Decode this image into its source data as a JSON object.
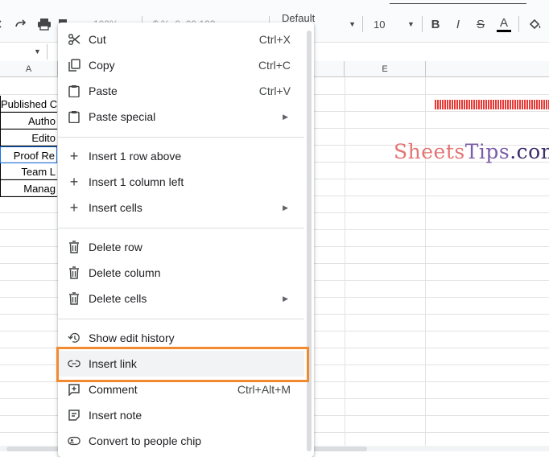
{
  "toolbar": {
    "zoom": "100%",
    "font_name": "Default (Ari...",
    "font_size": "10",
    "bold": "B",
    "italic": "I",
    "strikethrough": "S",
    "text_color": "A",
    "faded_tools": "$   %   .0   .00   123"
  },
  "columns": {
    "a": "A",
    "e": "E"
  },
  "cells": [
    "Published C",
    "Autho",
    "Edito",
    "Proof Re",
    "Team L",
    "Manag"
  ],
  "watermark": {
    "part1": "Sheets",
    "part2": "Tips",
    "part3": ".com"
  },
  "menu": {
    "cut": {
      "label": "Cut",
      "shortcut": "Ctrl+X"
    },
    "copy": {
      "label": "Copy",
      "shortcut": "Ctrl+C"
    },
    "paste": {
      "label": "Paste",
      "shortcut": "Ctrl+V"
    },
    "paste_special": {
      "label": "Paste special"
    },
    "insert_row_above": {
      "label": "Insert 1 row above"
    },
    "insert_column_left": {
      "label": "Insert 1 column left"
    },
    "insert_cells": {
      "label": "Insert cells"
    },
    "delete_row": {
      "label": "Delete row"
    },
    "delete_column": {
      "label": "Delete column"
    },
    "delete_cells": {
      "label": "Delete cells"
    },
    "show_edit_history": {
      "label": "Show edit history"
    },
    "insert_link": {
      "label": "Insert link"
    },
    "comment": {
      "label": "Comment",
      "shortcut": "Ctrl+Alt+M"
    },
    "insert_note": {
      "label": "Insert note"
    },
    "convert_people_chip": {
      "label": "Convert to people chip"
    }
  },
  "colors": {
    "highlight": "#f28b30",
    "hover_bg": "#f1f3f4",
    "selection": "#1a73e8"
  }
}
